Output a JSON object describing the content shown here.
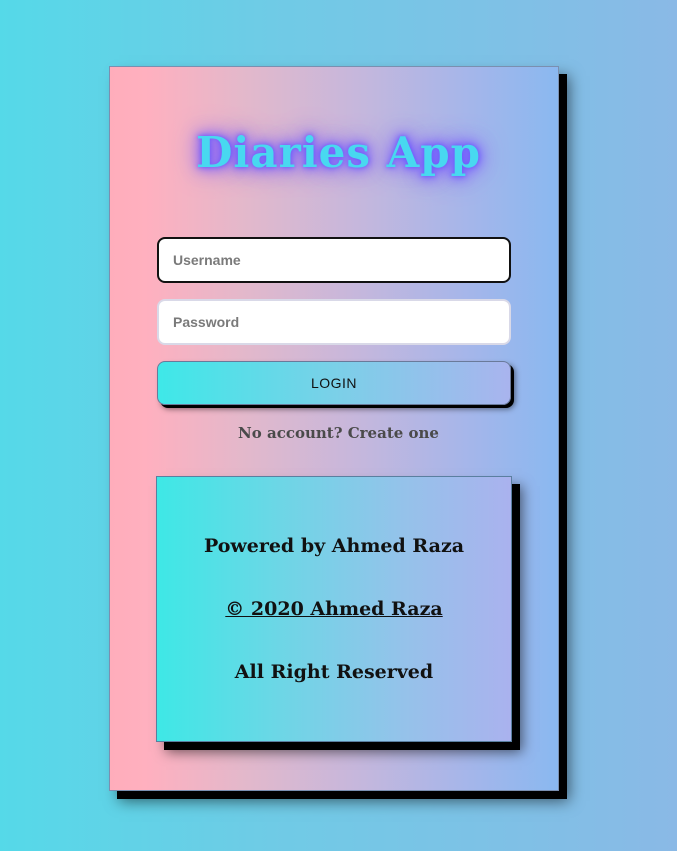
{
  "app": {
    "title": "Diaries App"
  },
  "login_form": {
    "username_placeholder": "Username",
    "username_value": "",
    "password_placeholder": "Password",
    "password_value": "",
    "login_label": "LOGIN",
    "signup_text": "No account? Create one"
  },
  "footer": {
    "powered_by": "Powered by Ahmed Raza",
    "copyright": "© 2020 Ahmed Raza",
    "rights": "All Right Reserved"
  },
  "colors": {
    "title_glow": "#6b5bff",
    "title_text": "#48d8f0",
    "button_gradient_start": "#3ee8e8",
    "button_gradient_end": "#a9b4ee"
  }
}
